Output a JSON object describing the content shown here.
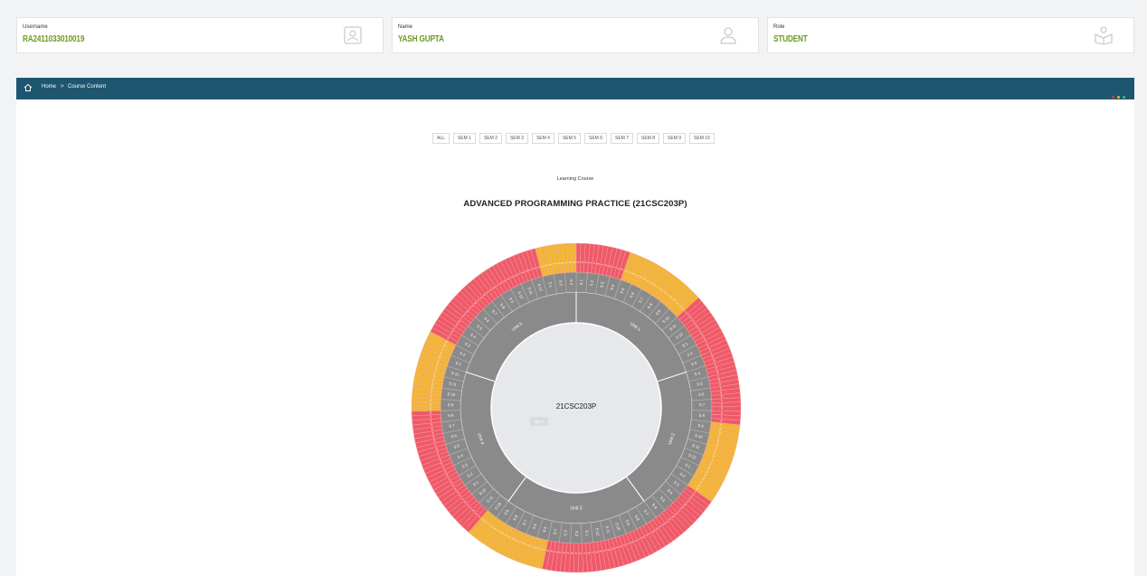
{
  "profile": {
    "username": {
      "label": "Username",
      "value": "RA2411033010019",
      "icon": "id-card-icon"
    },
    "name": {
      "label": "Name",
      "value": "YASH GUPTA",
      "icon": "user-icon"
    },
    "role": {
      "label": "Role",
      "value": "STUDENT",
      "icon": "student-icon"
    }
  },
  "breadcrumb": {
    "home": "Home",
    "separator": ">",
    "current": "Course Content"
  },
  "nav_dots": [
    "#e3344f",
    "#f2b21d",
    "#3fbf5a"
  ],
  "semester_tabs": [
    "ALL",
    "SEM 1",
    "SEM 2",
    "SEM 3",
    "SEM 4",
    "SEM 5",
    "SEM 6",
    "SEM 7",
    "SEM 8",
    "SEM 9",
    "SEM 10"
  ],
  "section_label": "Learning Course",
  "course_title": "ADVANCED PROGRAMMING PRACTICE (21CSC203P)",
  "wheel": {
    "center_label": "21CSC203P",
    "center_badge": "SEC 2",
    "units": [
      {
        "name": "Unit 1",
        "sessions": [
          "S 1",
          "S 2",
          "S 3",
          "S 4",
          "S 5",
          "S 6",
          "S 7",
          "S 8",
          "S 9",
          "S 10",
          "S 11",
          "S 12",
          "S 1",
          "S 2",
          "S 3"
        ]
      },
      {
        "name": "Unit 2",
        "sessions": [
          "S 4",
          "S 5",
          "S 6",
          "S 7",
          "S 8",
          "S 9",
          "S 10",
          "S 11",
          "S 12",
          "S 1",
          "S 2",
          "S 3",
          "S 4",
          "S 5",
          "S 6"
        ]
      },
      {
        "name": "Unit 3",
        "sessions": [
          "S 7",
          "S 8",
          "S 9",
          "S 10",
          "S 11",
          "S 12",
          "S 1",
          "S 2",
          "S 3",
          "S 4",
          "S 5",
          "S 6",
          "S 7",
          "S 8",
          "S 9"
        ]
      },
      {
        "name": "Unit 4",
        "sessions": [
          "S 10",
          "S 11",
          "S 12",
          "S 1",
          "S 2",
          "S 3",
          "S 4",
          "S 5",
          "S 6",
          "S 7",
          "S 8",
          "S 9",
          "S 10",
          "S 11",
          "S 12"
        ]
      },
      {
        "name": "Unit 5",
        "sessions": [
          "S 1",
          "S 2",
          "S 3",
          "S 4",
          "S 5",
          "S 6",
          "S 7",
          "S 8",
          "S 9",
          "S 10",
          "S 11",
          "S 12",
          "S 1",
          "S 2",
          "S 3"
        ]
      }
    ],
    "outer_labels": [
      "1",
      "2",
      "3"
    ],
    "colors": {
      "red": "#ef5a68",
      "yellow": "#f2b534",
      "grey": "#8a8a8a",
      "center": "#e6e8eb"
    }
  }
}
